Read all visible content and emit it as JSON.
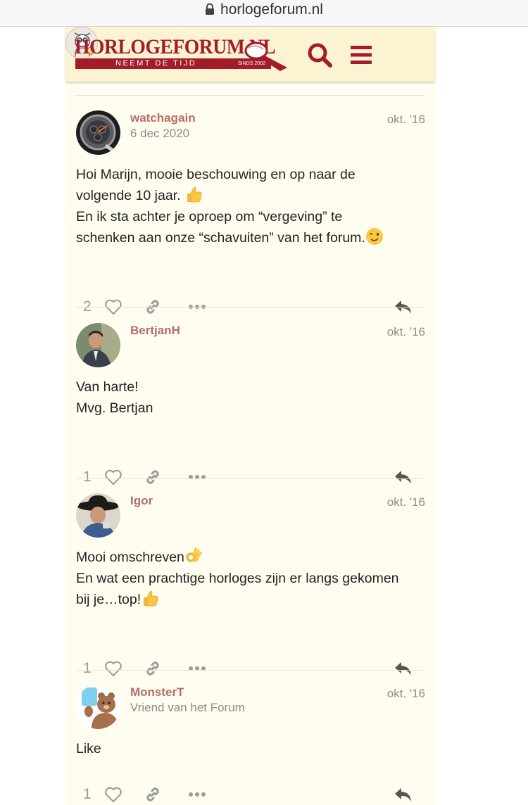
{
  "browser": {
    "url": "horlogeforum.nl"
  },
  "header": {
    "logo_title": "HORLOGEFORUM.NL",
    "logo_tagline": "NEEMT DE TIJD",
    "logo_since": "SINDS 2002",
    "brand_color": "#a21c2b",
    "icons": [
      "search-icon",
      "hamburger-menu-icon",
      "user-avatar"
    ]
  },
  "posts": [
    {
      "username": "watchagain",
      "user_title": "6 dec 2020",
      "date": "okt. '16",
      "lines": [
        "Hoi Marijn, mooie beschouwing en op naar de",
        "volgende 10 jaar.",
        "En ik sta achter je oproep om “vergeving” te",
        "schenken aan onze “schavuiten” van het forum."
      ],
      "likes": "2"
    },
    {
      "username": "BertjanH",
      "user_title": "",
      "date": "okt. '16",
      "lines": [
        "Van harte!",
        "Mvg. Bertjan"
      ],
      "likes": "1"
    },
    {
      "username": "Igor",
      "user_title": "",
      "date": "okt. '16",
      "lines": [
        "Mooi omschreven",
        "En wat een prachtige horloges zijn er langs gekomen",
        "bij je…top!"
      ],
      "likes": "1"
    },
    {
      "username": "MonsterT",
      "user_title": "Vriend van het Forum",
      "date": "okt. '16",
      "lines": [
        "Like"
      ],
      "likes": "1"
    }
  ],
  "colors": {
    "username": "#b76e66",
    "muted": "#8c8c8c",
    "page_bg": "#fffdf0",
    "header_bg": "#fcf3d3"
  }
}
